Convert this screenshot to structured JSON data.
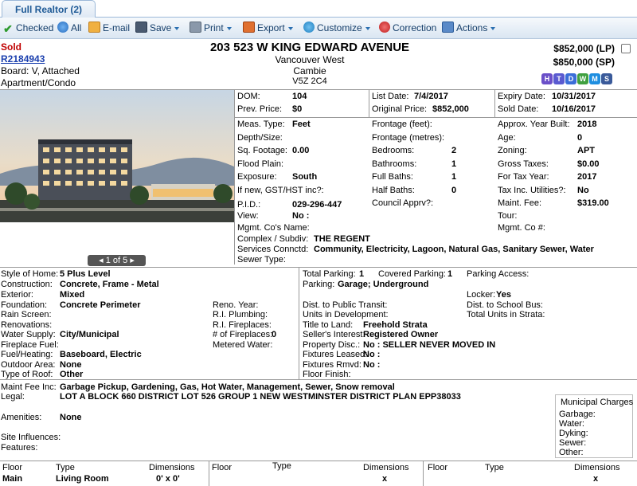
{
  "tab": {
    "label": "Full Realtor (2)"
  },
  "toolbar": {
    "checked": "Checked",
    "all": "All",
    "email": "E-mail",
    "save": "Save",
    "print": "Print",
    "export": "Export",
    "customize": "Customize",
    "correction": "Correction",
    "actions": "Actions"
  },
  "header": {
    "status": "Sold",
    "mls": "R2184943",
    "board": "Board: V, Attached",
    "type": "Apartment/Condo",
    "address": "203 523 W KING EDWARD AVENUE",
    "area": "Vancouver West",
    "subarea": "Cambie",
    "postal": "V5Z 2C4",
    "lp": "$852,000 (LP)",
    "sp": "$850,000 (SP)",
    "icons": [
      "H",
      "T",
      "D",
      "W",
      "M",
      "S"
    ]
  },
  "photo": {
    "pager": "1 of 5"
  },
  "details": {
    "dom_l": "DOM:",
    "dom": "104",
    "prev_l": "Prev. Price:",
    "prev": "$0",
    "listdate_l": "List Date:",
    "listdate": "7/4/2017",
    "origprice_l": "Original Price:",
    "origprice": "$852,000",
    "expiry_l": "Expiry Date:",
    "expiry": "10/31/2017",
    "sold_l": "Sold Date:",
    "sold": "10/16/2017",
    "meas_l": "Meas. Type:",
    "meas": "Feet",
    "depth_l": "Depth/Size:",
    "sqft_l": "Sq. Footage:",
    "sqft": "0.00",
    "flood_l": "Flood Plain:",
    "exposure_l": "Exposure:",
    "exposure": "South",
    "gst_l": "If new, GST/HST inc?:",
    "pid_l": "P.I.D.:",
    "pid": "029-296-447",
    "view_l": "View:",
    "view": "No :",
    "frontft_l": "Frontage (feet):",
    "frontm_l": "Frontage (metres):",
    "bed_l": "Bedrooms:",
    "bed": "2",
    "bath_l": "Bathrooms:",
    "bath": "1",
    "fullbath_l": "Full Baths:",
    "fullbath": "1",
    "halfbath_l": "Half Baths:",
    "halfbath": "0",
    "council_l": "Council Apprv?:",
    "year_l": "Approx. Year Built:",
    "year": "2018",
    "age_l": "Age:",
    "age": "0",
    "zoning_l": "Zoning:",
    "zoning": "APT",
    "taxes_l": "Gross Taxes:",
    "taxes": "$0.00",
    "taxyear_l": "For Tax Year:",
    "taxyear": "2017",
    "taxutil_l": "Tax Inc. Utilities?:",
    "taxutil": "No",
    "maint_l": "Maint. Fee:",
    "maint": "$319.00",
    "tour_l": "Tour:",
    "mgmt_l": "Mgmt. Co's Name:",
    "mgmtno_l": "Mgmt. Co #:",
    "complex_l": "Complex / Subdiv:",
    "complex": "THE REGENT",
    "services_l": "Services Connctd:",
    "services": "Community, Electricity, Lagoon, Natural Gas, Sanitary Sewer, Water",
    "sewer_l": "Sewer Type:"
  },
  "construction": {
    "style_l": "Style of Home:",
    "style": "5 Plus Level",
    "constr_l": "Construction:",
    "constr": "Concrete, Frame - Metal",
    "exterior_l": "Exterior:",
    "exterior": "Mixed",
    "foundation_l": "Foundation:",
    "foundation": "Concrete Perimeter",
    "rain_l": "Rain Screen:",
    "renos_l": "Renovations:",
    "water_l": "Water Supply:",
    "water": "City/Municipal",
    "fireplace_l": "Fireplace Fuel:",
    "fuel_l": "Fuel/Heating:",
    "fuel": "Baseboard, Electric",
    "outdoor_l": "Outdoor Area:",
    "outdoor": "None",
    "roof_l": "Type of Roof:",
    "roof": "Other",
    "renoyear_l": "Reno. Year:",
    "riplumb_l": "R.I. Plumbing:",
    "rifire_l": "R.I. Fireplaces:",
    "numfire_l": "# of Fireplaces:",
    "numfire": "0",
    "metered_l": "Metered Water:"
  },
  "parking": {
    "total_l": "Total Parking:",
    "total": "1",
    "covered_l": "Covered Parking:",
    "covered": "1",
    "access_l": "Parking Access:",
    "park_l": "Parking:",
    "park": "Garage; Underground",
    "locker_l": "Locker:",
    "locker": "Yes",
    "transit_l": "Dist. to Public Transit:",
    "school_l": "Dist. to School Bus:",
    "units_l": "Units in Development:",
    "strata_l": "Total Units in Strata:",
    "title_l": "Title to Land:",
    "title": "Freehold Strata",
    "seller_l": "Seller's Interest:",
    "seller": "Registered Owner",
    "disc_l": "Property Disc.:",
    "disc": "No : SELLER NEVER MOVED IN",
    "leased_l": "Fixtures Leased:",
    "leased": "No :",
    "rmvd_l": "Fixtures Rmvd:",
    "rmvd": "No :",
    "floorfin_l": "Floor Finish:"
  },
  "legal": {
    "maintinc_l": "Maint Fee Inc:",
    "maintinc": "Garbage Pickup, Gardening, Gas, Hot Water, Management, Sewer, Snow removal",
    "legal_l": "Legal:",
    "legal": "LOT A BLOCK 660 DISTRICT LOT 526 GROUP 1 NEW WESTMINSTER DISTRICT PLAN EPP38033",
    "amen_l": "Amenities:",
    "amen": "None",
    "site_l": "Site Influences:",
    "feat_l": "Features:"
  },
  "municipal": {
    "title": "Municipal Charges",
    "garbage": "Garbage:",
    "water": "Water:",
    "dyking": "Dyking:",
    "sewer": "Sewer:",
    "other": "Other:"
  },
  "rooms": {
    "h_floor": "Floor",
    "h_type": "Type",
    "h_dim": "Dimensions",
    "r1_floor": "Main",
    "r1_type": "Living Room",
    "r1_dim": "0' x 0'",
    "r2_dim": "x",
    "r3_dim": "x"
  }
}
